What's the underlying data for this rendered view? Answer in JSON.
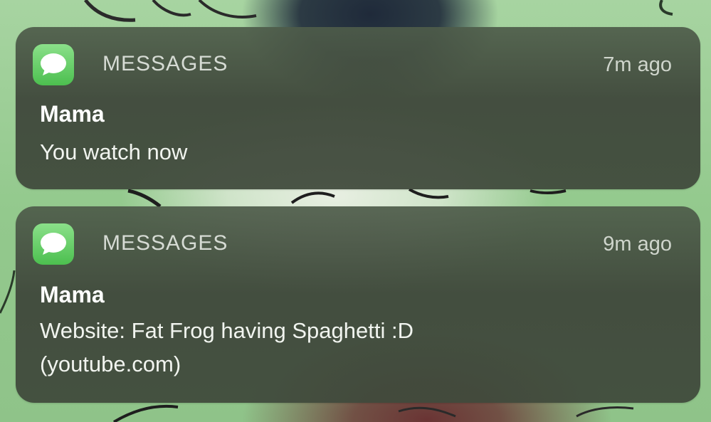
{
  "notifications": [
    {
      "app_name": "MESSAGES",
      "app_icon": "messages-icon",
      "time": "7m ago",
      "sender": "Mama",
      "body_lines": [
        "You watch now"
      ]
    },
    {
      "app_name": "MESSAGES",
      "app_icon": "messages-icon",
      "time": "9m ago",
      "sender": "Mama",
      "body_lines": [
        "Website: Fat Frog having Spaghetti :D",
        "(youtube.com)"
      ]
    }
  ],
  "colors": {
    "wallpaper_green": "#93c98d",
    "notification_background": "#3e463a",
    "app_icon_green": "#4cbf4f"
  }
}
